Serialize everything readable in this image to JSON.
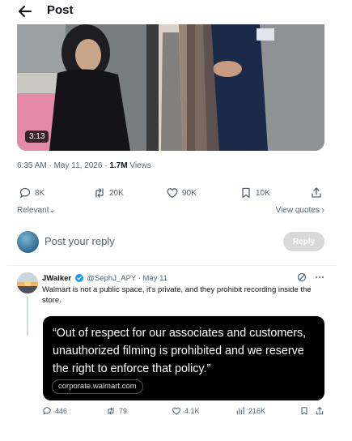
{
  "header": {
    "title": "Post"
  },
  "video": {
    "duration": "3:13"
  },
  "meta": {
    "time": "6:35 AM · May 11, 2026 · ",
    "views_count": "1.7M",
    "views_label": " Views"
  },
  "actions": {
    "replies": "8K",
    "reposts": "20K",
    "likes": "90K",
    "bookmarks": "10K"
  },
  "sort": {
    "relevant": "Relevant⌄",
    "view_quotes": "View quotes ›"
  },
  "reply": {
    "placeholder": "Post your reply",
    "button": "Reply"
  },
  "comment": {
    "name": "JWalker",
    "handle": "@SephJ_APY",
    "date": "· May 11",
    "text": "Walmart is not a public space, it's private, and they prohibit recording inside the store.",
    "quote": "“Out of respect for our associates and customers, unauthorized filming is prohibited and we reserve the right to enforce that policy.”",
    "link": "corporate.walmart.com",
    "replies": "446",
    "reposts": "79",
    "likes": "4.1K",
    "views": "216K",
    "accent": "#1d9bf0"
  }
}
